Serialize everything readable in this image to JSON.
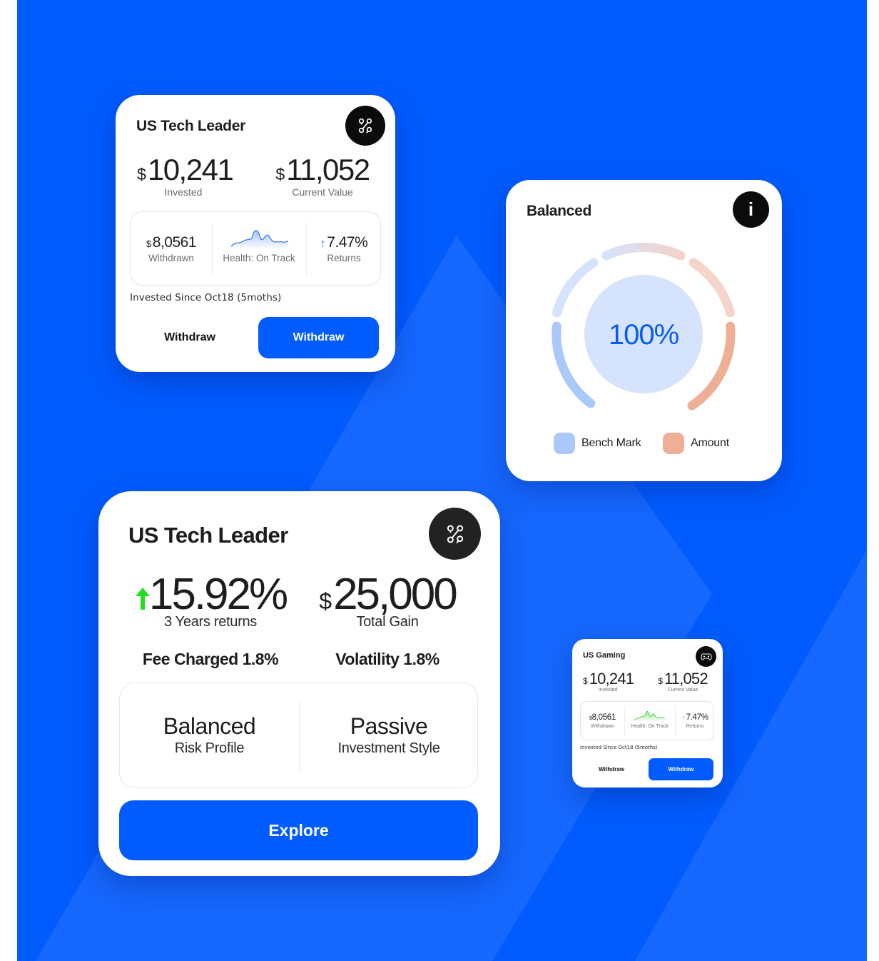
{
  "colors": {
    "background": "#005cff",
    "background_shape": "#1668ff",
    "primary": "#005cff",
    "icon_bg": "#0b0b0b",
    "positive_blue": "#1e6bff",
    "positive_green": "#22dd22",
    "benchmark": "#a9c9fb",
    "amount": "#efae96",
    "gauge_center": "#d5e4fc",
    "gauge_text": "#0a5cf0"
  },
  "card_small_tech": {
    "title": "US Tech Leader",
    "icon": "route-nodes-icon",
    "invested": {
      "currency": "$",
      "value": "10,241",
      "label": "Invested"
    },
    "current": {
      "currency": "$",
      "value": "11,052",
      "label": "Current Value"
    },
    "withdrawn": {
      "currency": "$",
      "value": "8,0561",
      "label": "Withdrawn"
    },
    "health": {
      "label": "Health: On Track",
      "sparkline_color": "#3b7cf5"
    },
    "returns": {
      "arrow": "↑",
      "value": "7.47%",
      "label": "Returns"
    },
    "since": "Invested Since Oct18 (5moths)",
    "secondary_button": "Withdraw",
    "primary_button": "Withdraw"
  },
  "card_balanced": {
    "title": "Balanced",
    "icon": "info-icon",
    "info_glyph": "i",
    "center_value": "100%",
    "legend": [
      {
        "label": "Bench Mark",
        "color": "#a9c9fb"
      },
      {
        "label": "Amount",
        "color": "#efae96"
      }
    ]
  },
  "card_big_tech": {
    "title": "US Tech Leader",
    "icon": "route-nodes-icon",
    "returns": {
      "arrow": "↑",
      "value": "15.92%",
      "label": "3 Years returns"
    },
    "gain": {
      "currency": "$",
      "value": "25,000",
      "label": "Total Gain"
    },
    "fee": "Fee Charged 1.8%",
    "volatility": "Volatility 1.8%",
    "risk": {
      "value": "Balanced",
      "label": "Risk Profile"
    },
    "style": {
      "value": "Passive",
      "label": "Investment Style"
    },
    "button": "Explore"
  },
  "card_gaming": {
    "title": "US Gaming",
    "icon": "gamepad-icon",
    "invested": {
      "currency": "$",
      "value": "10,241",
      "label": "Invested"
    },
    "current": {
      "currency": "$",
      "value": "11,052",
      "label": "Current Value"
    },
    "withdrawn": {
      "currency": "$",
      "value": "8,0561",
      "label": "Withdrawn"
    },
    "health": {
      "label": "Health: On Track",
      "sparkline_color": "#3ccf3c"
    },
    "returns": {
      "arrow": "↑",
      "value": "7.47%",
      "label": "Returns"
    },
    "since": "Invested Since Oct18 (5moths)",
    "secondary_button": "Withdraw",
    "primary_button": "Withdraw"
  }
}
